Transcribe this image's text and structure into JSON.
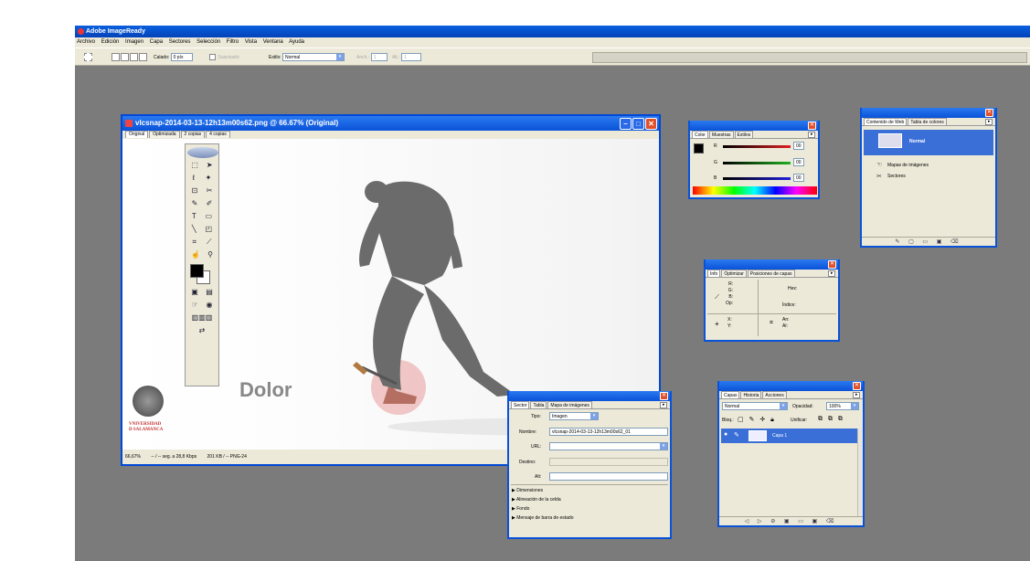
{
  "app": {
    "title": "Adobe ImageReady"
  },
  "menu": [
    "Archivo",
    "Edición",
    "Imagen",
    "Capa",
    "Sectores",
    "Selección",
    "Filtro",
    "Vista",
    "Ventana",
    "Ayuda"
  ],
  "options_bar": {
    "calado_label": "Calado:",
    "calado_value": "0 píx",
    "suavizado_label": "Suavizado",
    "estilo_label": "Estilo:",
    "estilo_value": "Normal",
    "anch_label": "Anch.:",
    "anch_value": "1",
    "alt_label": "Alt.:",
    "alt_value": "1"
  },
  "document": {
    "title": "vlcsnap-2014-03-13-12h13m00s62.png @ 66.67% (Original)",
    "tabs": [
      "Original",
      "Optimizada",
      "2 copias",
      "4 copias"
    ],
    "overlay_text": "Dolor",
    "university": [
      "VNIVERSIDAD",
      "D SALAMANCA"
    ],
    "status": [
      "66,67%",
      "-- / -- seg. a 28,8 Kbps",
      "201 KB / -- PNG-24"
    ]
  },
  "panels": {
    "color": {
      "tabs": [
        "Color",
        "Muestras",
        "Estilos"
      ],
      "channels": [
        {
          "label": "R",
          "value": "00",
          "color": "#e02020"
        },
        {
          "label": "G",
          "value": "00",
          "color": "#20b020"
        },
        {
          "label": "B",
          "value": "00",
          "color": "#2020d8"
        }
      ]
    },
    "web": {
      "tabs": [
        "Contenido de Web",
        "Tabla de colores"
      ],
      "items": [
        "Normal",
        "Mapas de imágenes",
        "Sectores"
      ]
    },
    "info": {
      "tabs": [
        "Info",
        "Optimizar",
        "Posiciones de capas"
      ],
      "rgb_labels": "R:\nG:\nB:\nOp:",
      "hex_label": "Hex:",
      "indice_label": "Índice:",
      "xy_labels": "X:\nY:",
      "size_labels": "An:\nAl:"
    },
    "sector": {
      "tabs": [
        "Sector",
        "Tabla",
        "Mapa de imágenes"
      ],
      "tipo_label": "Tipo:",
      "tipo_value": "Imagen",
      "nombre_label": "Nombre:",
      "nombre_value": "vlcsnap-2014-03-13-12h13m00s62_01",
      "url_label": "URL:",
      "destino_label": "Destino:",
      "alt_label": "Alt:",
      "sections": [
        "Dimensiones",
        "Alineación de la celda",
        "Fondo",
        "Mensaje de barra de estado"
      ]
    },
    "layers": {
      "tabs": [
        "Capas",
        "Historia",
        "Acciones"
      ],
      "mode": "Normal",
      "opacity_label": "Opacidad:",
      "opacity_value": "100%",
      "lock_label": "Bloq.:",
      "unify_label": "Unificar:",
      "layer_name": "Capa 1"
    }
  }
}
